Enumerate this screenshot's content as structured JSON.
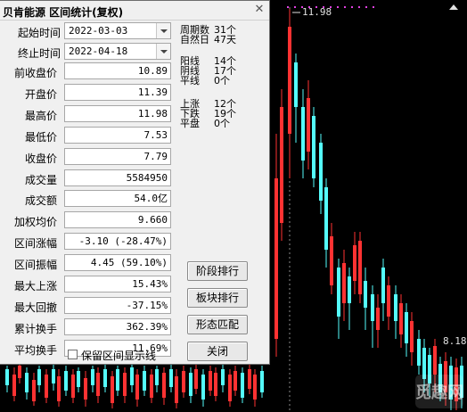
{
  "dialog": {
    "title": "贝肯能源 区间统计(复权)",
    "close_glyph": "✕",
    "start_label": "起始时间",
    "start_value": "2022-03-03",
    "end_label": "终止时间",
    "end_value": "2022-04-18",
    "fields": [
      {
        "label": "前收盘价",
        "value": "10.89"
      },
      {
        "label": "开盘价",
        "value": "11.39"
      },
      {
        "label": "最高价",
        "value": "11.98"
      },
      {
        "label": "最低价",
        "value": "7.53"
      },
      {
        "label": "收盘价",
        "value": "7.79"
      },
      {
        "label": "成交量",
        "value": "5584950"
      },
      {
        "label": "成交额",
        "value": "54.0亿"
      },
      {
        "label": "加权均价",
        "value": "9.660"
      },
      {
        "label": "区间涨幅",
        "value": "-3.10 (-28.47%)"
      },
      {
        "label": "区间振幅",
        "value": "4.45 (59.10%)"
      },
      {
        "label": "最大上涨",
        "value": "15.43%"
      },
      {
        "label": "最大回撤",
        "value": "-37.15%"
      },
      {
        "label": "累计换手",
        "value": "362.39%"
      },
      {
        "label": "平均换手",
        "value": "11.69%"
      }
    ],
    "period_stats": [
      {
        "label": "周期数",
        "value": "31个"
      },
      {
        "label": "自然日",
        "value": "47天"
      }
    ],
    "candle_stats": [
      {
        "label": "阳线",
        "value": "14个"
      },
      {
        "label": "阴线",
        "value": "17个"
      },
      {
        "label": "平线",
        "value": "0个"
      }
    ],
    "move_stats": [
      {
        "label": "上涨",
        "value": "12个"
      },
      {
        "label": "下跌",
        "value": "19个"
      },
      {
        "label": "平盘",
        "value": "0个"
      }
    ],
    "buttons": {
      "stage_rank": "阶段排行",
      "sector_rank": "板块排行",
      "pattern_match": "形态匹配",
      "close": "关闭"
    },
    "keep_interval_label": "保留区间显示线"
  },
  "chart": {
    "high_label": "11.98",
    "low_label": "8.18",
    "watermark": "觅趣网",
    "colors": {
      "up": "#ff3232",
      "down": "#54fcfc",
      "marker": "#e040e0",
      "background": "#000000"
    }
  },
  "chart_data": {
    "type": "candlestick",
    "title": "",
    "annotations": [
      "11.98",
      "8.18"
    ]
  }
}
